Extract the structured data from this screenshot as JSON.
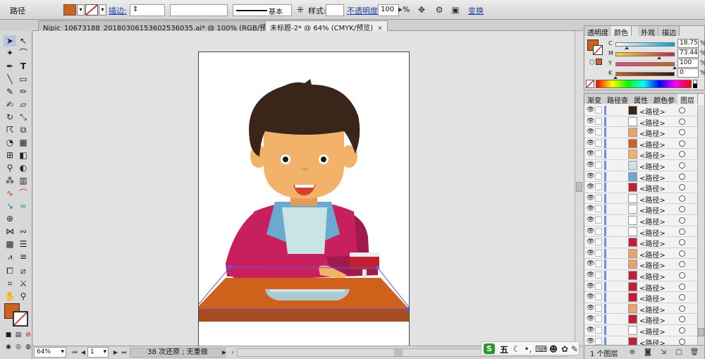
{
  "control_bar": {
    "object_label": "路径",
    "fill_color": "#d0611a",
    "stroke_label": "描边:",
    "stroke_profile_label": "基本",
    "style_label": "样式:",
    "opacity_label": "不透明度:",
    "opacity_value": "100",
    "opacity_unit": "%",
    "transform_label": "变换"
  },
  "document_tabs": [
    {
      "label": "Nipic_10673188_20180306153602536035.ai* @ 100% (RGB/预览)",
      "active": false
    },
    {
      "label": "未标题-2* @ 64% (CMYK/预览)",
      "active": true
    }
  ],
  "color_panel": {
    "tabs": [
      "透明度",
      "颜色",
      "外观",
      "描边"
    ],
    "active_tab": "颜色",
    "fill_color": "#d0611a",
    "channels": [
      {
        "name": "C",
        "value": "18.75",
        "unit": "%",
        "level": 0.1875
      },
      {
        "name": "M",
        "value": "73.44",
        "unit": "%",
        "level": 0.7344
      },
      {
        "name": "Y",
        "value": "100",
        "unit": "%",
        "level": 1.0
      },
      {
        "name": "K",
        "value": "0",
        "unit": "%",
        "level": 0.0
      }
    ]
  },
  "layers_panel": {
    "tabs": [
      "渐变",
      "路径查",
      "属性",
      "颜色参",
      "图层"
    ],
    "active_tab": "图层",
    "rows": [
      {
        "name": "<路径>",
        "thumb_color": "#3a2618"
      },
      {
        "name": "<路径>",
        "thumb_color": "#ffffff"
      },
      {
        "name": "<路径>",
        "thumb_color": "#e9a46a"
      },
      {
        "name": "<路径>",
        "thumb_color": "#d0611a"
      },
      {
        "name": "<路径>",
        "thumb_color": "#f2b26a"
      },
      {
        "name": "<路径>",
        "thumb_color": "#c8e4e6"
      },
      {
        "name": "<路径>",
        "thumb_color": "#6aaad0"
      },
      {
        "name": "<路径>",
        "thumb_color": "#c01f36"
      },
      {
        "name": "<路径>",
        "thumb_color": "#ffffff"
      },
      {
        "name": "<路径>",
        "thumb_color": "#ffffff"
      },
      {
        "name": "<路径>",
        "thumb_color": "#ffffff"
      },
      {
        "name": "<路径>",
        "thumb_color": "#ffffff"
      },
      {
        "name": "<路径>",
        "thumb_color": "#c01f36"
      },
      {
        "name": "<路径>",
        "thumb_color": "#e9a46a"
      },
      {
        "name": "<路径>",
        "thumb_color": "#e9a46a"
      },
      {
        "name": "<路径>",
        "thumb_color": "#c01f36"
      },
      {
        "name": "<路径>",
        "thumb_color": "#c01f36"
      },
      {
        "name": "<路径>",
        "thumb_color": "#c01f36"
      },
      {
        "name": "<路径>",
        "thumb_color": "#e9a46a"
      },
      {
        "name": "<路径>",
        "thumb_color": "#c01f36"
      },
      {
        "name": "<路径>",
        "thumb_color": "#ffffff"
      },
      {
        "name": "<路径>",
        "thumb_color": "#c01f36"
      }
    ],
    "footer_label": "1 个图层"
  },
  "status_bar": {
    "zoom": "64%",
    "artboard_index": "1",
    "history_text": "38 次还原 ; 无重做"
  },
  "ime_bar": {
    "mode_label": "五"
  },
  "colors": {
    "skin": "#f2b26a",
    "hair": "#3a2618",
    "shirt": "#c8205e",
    "shirt_dark": "#a01a4e",
    "bib_light": "#c8e4e6",
    "bib_blue": "#6aaad0",
    "table_top": "#d0611a",
    "table_front": "#a84c20",
    "plate": "#a9c9d3",
    "wine": "#c01f2e",
    "mouth": "#d8402a"
  }
}
